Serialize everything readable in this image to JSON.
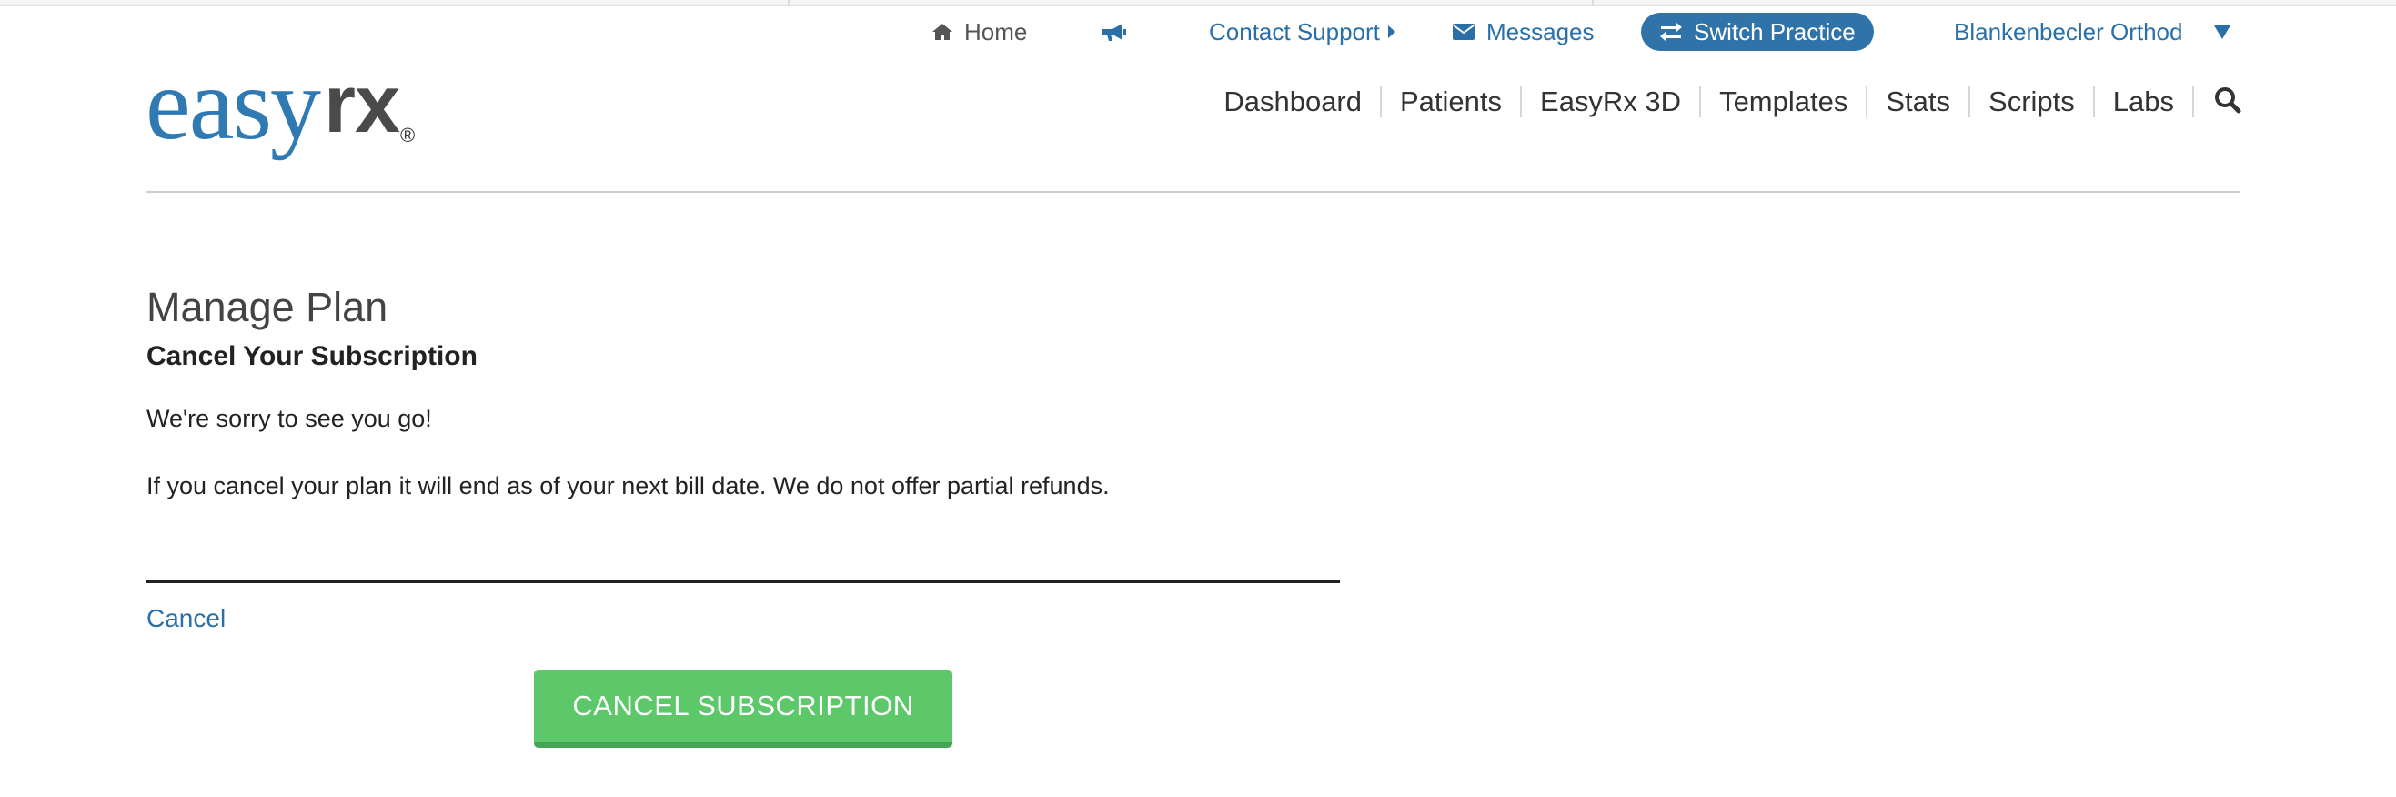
{
  "utility_bar": {
    "home_label": "Home",
    "announcements_icon": "megaphone-icon",
    "contact_support_label": "Contact Support",
    "messages_label": "Messages",
    "switch_practice_label": "Switch Practice",
    "user_name": "Blankenbecler Orthod"
  },
  "logo": {
    "easy": "easy",
    "rx": "rx",
    "registered": "®"
  },
  "main_nav": {
    "items": [
      {
        "label": "Dashboard"
      },
      {
        "label": "Patients"
      },
      {
        "label": "EasyRx 3D"
      },
      {
        "label": "Templates"
      },
      {
        "label": "Stats"
      },
      {
        "label": "Scripts"
      },
      {
        "label": "Labs"
      }
    ],
    "search_icon": "search-icon"
  },
  "content": {
    "page_title": "Manage Plan",
    "section_title": "Cancel Your Subscription",
    "sorry_text": "We're sorry to see you go!",
    "notice_text": "If you cancel your plan it will end as of your next bill date. We do not offer partial refunds.",
    "cancel_link": "Cancel",
    "cancel_subscription_button": "CANCEL SUBSCRIPTION"
  },
  "colors": {
    "brand_blue": "#2f7ab3",
    "link_blue": "#2a6fa8",
    "switch_pill": "#2f73a8",
    "button_green": "#5cc86a",
    "text_dark": "#222222"
  }
}
